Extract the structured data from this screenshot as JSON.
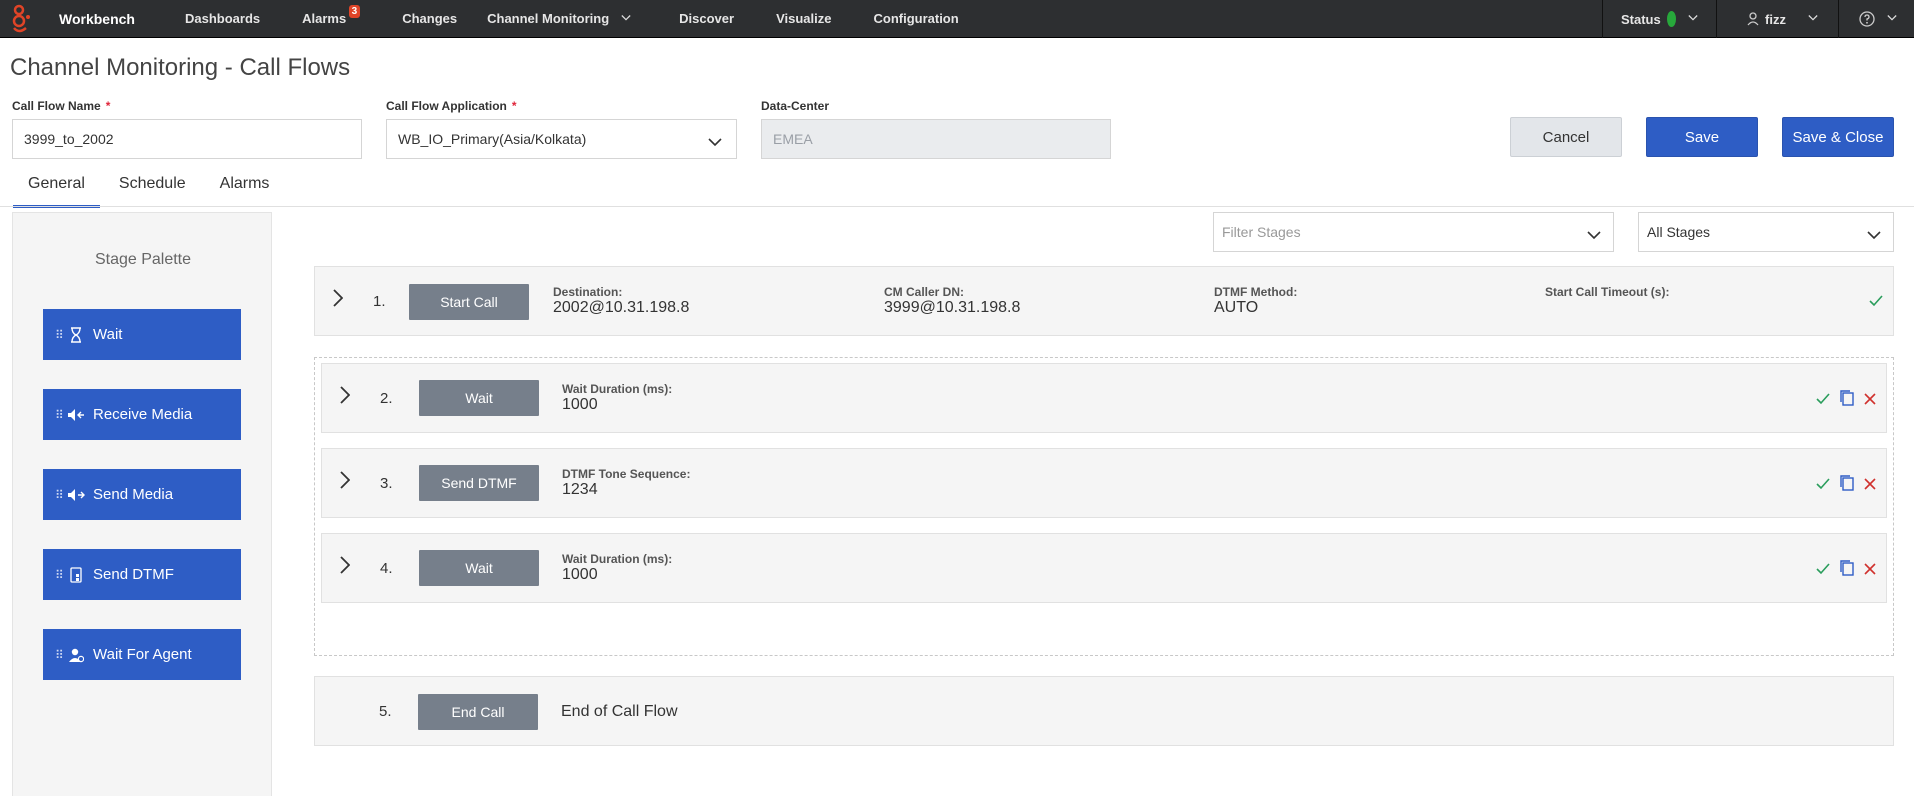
{
  "nav": {
    "brand": "Workbench",
    "items": [
      {
        "label": "Dashboards"
      },
      {
        "label": "Alarms",
        "badge": "3"
      },
      {
        "label": "Changes"
      },
      {
        "label": "Channel Monitoring"
      },
      {
        "label": "Discover"
      },
      {
        "label": "Visualize"
      },
      {
        "label": "Configuration"
      }
    ],
    "status_label": "Status",
    "user": "fizz"
  },
  "page": {
    "title": "Channel Monitoring - Call Flows"
  },
  "form": {
    "name_label": "Call Flow Name",
    "name_value": "3999_to_2002",
    "app_label": "Call Flow Application",
    "app_value": "WB_IO_Primary(Asia/Kolkata)",
    "dc_label": "Data-Center",
    "dc_value": "EMEA",
    "required_mark": "*"
  },
  "buttons": {
    "cancel": "Cancel",
    "save": "Save",
    "save_close": "Save & Close"
  },
  "tabs": [
    "General",
    "Schedule",
    "Alarms"
  ],
  "palette": {
    "title": "Stage Palette",
    "grip": "⠿",
    "items": [
      "Wait",
      "Receive Media",
      "Send Media",
      "Send DTMF",
      "Wait For Agent"
    ]
  },
  "filters": {
    "stage_filter_placeholder": "Filter Stages",
    "stage_scope": "All Stages"
  },
  "stages": [
    {
      "num": "1.",
      "name": "Start Call",
      "fields": [
        {
          "key": "Destination:",
          "value": "2002@10.31.198.8"
        },
        {
          "key": "CM Caller DN:",
          "value": "3999@10.31.198.8"
        },
        {
          "key": "DTMF Method:",
          "value": "AUTO"
        },
        {
          "key": "Start Call Timeout (s):",
          "value": ""
        }
      ]
    },
    {
      "num": "2.",
      "name": "Wait",
      "fields": [
        {
          "key": "Wait Duration (ms):",
          "value": "1000"
        }
      ]
    },
    {
      "num": "3.",
      "name": "Send DTMF",
      "fields": [
        {
          "key": "DTMF Tone Sequence:",
          "value": "1234"
        }
      ]
    },
    {
      "num": "4.",
      "name": "Wait",
      "fields": [
        {
          "key": "Wait Duration (ms):",
          "value": "1000"
        }
      ]
    },
    {
      "num": "5.",
      "name": "End Call",
      "description": "End of Call Flow"
    }
  ],
  "colors": {
    "accent": "#2e5dc5",
    "nav_bg": "#2d2f31",
    "stage_button": "#767f8b",
    "check": "#2a9d5c",
    "delete": "#d0312d",
    "status_ok": "#27a83b",
    "logo": "#e04427"
  }
}
